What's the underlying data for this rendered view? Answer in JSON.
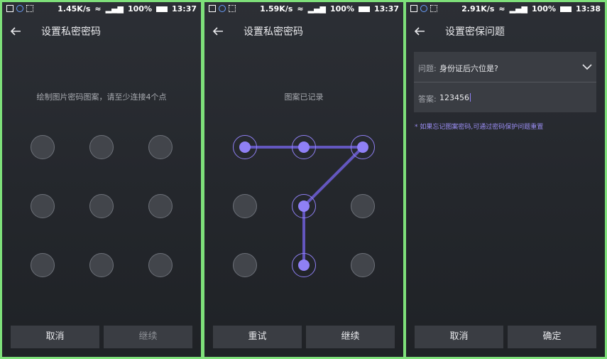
{
  "panels": [
    {
      "status": {
        "speed": "1.45K/s",
        "battery": "100%",
        "time": "13:37"
      },
      "title": "设置私密密码",
      "hint": "绘制图片密码图案，请至少连接4个点",
      "buttons": {
        "cancel": "取消",
        "continue": "继续"
      },
      "dots_active": []
    },
    {
      "status": {
        "speed": "1.59K/s",
        "battery": "100%",
        "time": "13:37"
      },
      "title": "设置私密密码",
      "hint": "图案已记录",
      "buttons": {
        "retry": "重试",
        "continue": "继续"
      },
      "dots_active": [
        0,
        1,
        2,
        4,
        7
      ],
      "pattern_path": [
        0,
        1,
        2,
        4,
        7
      ]
    },
    {
      "status": {
        "speed": "2.91K/s",
        "battery": "100%",
        "time": "13:38"
      },
      "title": "设置密保问题",
      "question_label": "问题:",
      "question_value": "身份证后六位是?",
      "answer_label": "答案:",
      "answer_value": "123456",
      "note": "* 如果忘记图案密码,可通过密码保护问题重置",
      "buttons": {
        "cancel": "取消",
        "confirm": "确定"
      }
    }
  ],
  "colors": {
    "accent": "#8f80f5",
    "panel_bg": "#24272c",
    "border": "#7ee07a"
  },
  "icons": {
    "back": "arrow-left-icon",
    "dropdown": "chevron-down-icon"
  }
}
